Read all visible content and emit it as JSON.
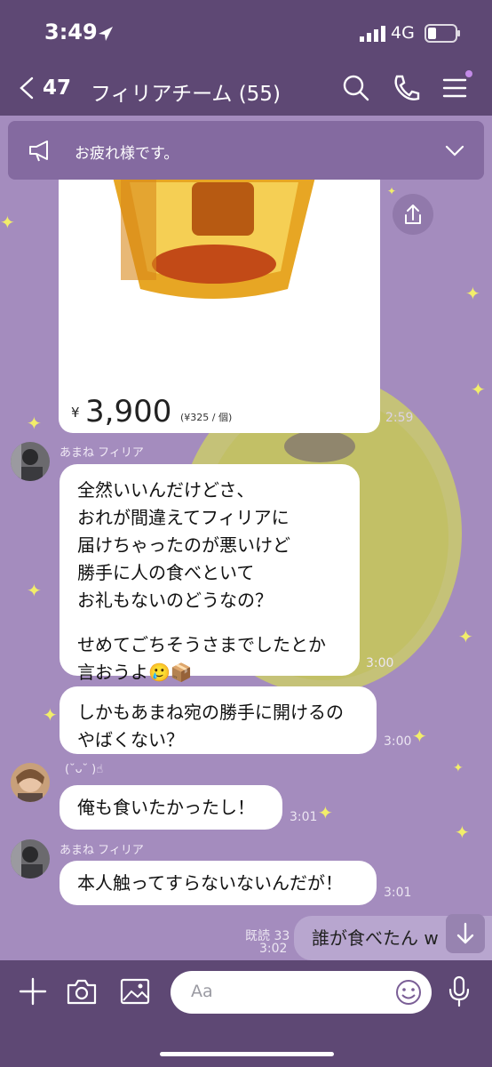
{
  "status": {
    "time": "3:49",
    "network": "4G"
  },
  "header": {
    "back_count": "47",
    "title": "フィリアチーム (55)"
  },
  "announcement": {
    "text": "お疲れ様です。"
  },
  "product": {
    "currency": "¥",
    "price": "3,900",
    "unit_price": "(¥325 / 個)",
    "time": "2:59"
  },
  "messages": [
    {
      "sender": "あまね フィリア",
      "lines": [
        "全然いいんだけどさ、",
        "おれが間違えてフィリアに",
        "届けちゃったのが悪いけど",
        "勝手に人の食べといて",
        "お礼もないのどうなの？",
        "",
        "せめてごちそうさまでしたとか",
        "言おうよ🥲📦"
      ],
      "time": "3:00"
    },
    {
      "sender": "",
      "lines": [
        "しかもあまね宛の勝手に開けるの",
        "やばくない？"
      ],
      "time": "3:00"
    },
    {
      "sender": "(˘ᴗ˘ )☝︎",
      "lines": [
        "俺も食いたかったし！"
      ],
      "time": "3:01"
    },
    {
      "sender": "あまね フィリア",
      "lines": [
        "本人触ってすらないないんだが！"
      ],
      "time": "3:01"
    }
  ],
  "outgoing": {
    "read": "既読 33",
    "time": "3:02",
    "text": "誰が食べたん w"
  },
  "composer": {
    "placeholder": "Aa"
  },
  "colors": {
    "header": "#5e4874",
    "chat_bg": "#a48cbe",
    "bubble": "#ffffff",
    "sparkle": "#f2ee6a"
  }
}
